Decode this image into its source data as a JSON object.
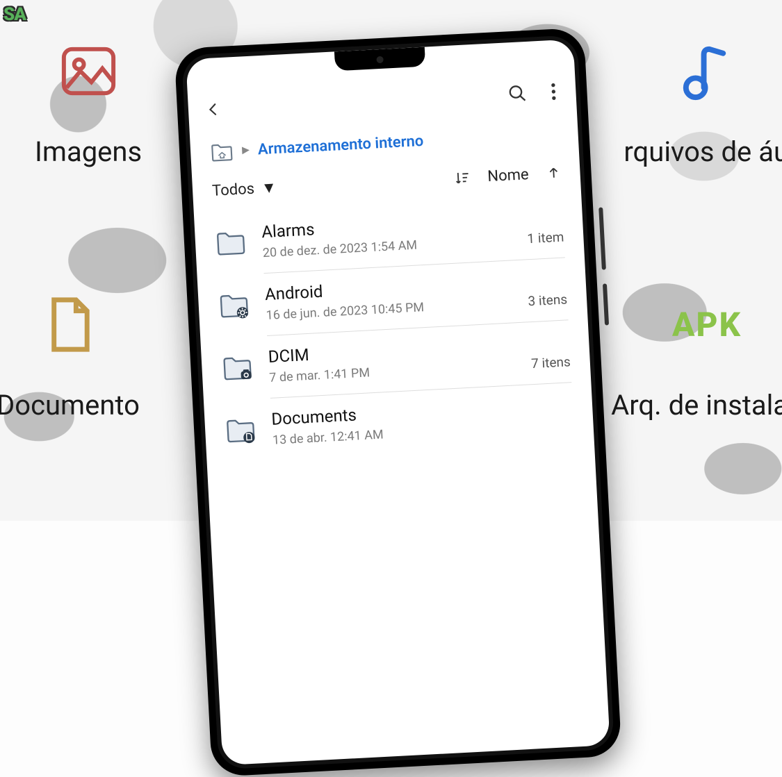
{
  "watermark": "SA",
  "categories": {
    "images_label": "Imagens",
    "audio_label": "rquivos de áu",
    "documents_label": "Documento",
    "apk_label": "Arq. de instalaç",
    "apk_icon_text": "APK"
  },
  "app": {
    "breadcrumb": {
      "current": "Armazenamento interno"
    },
    "filter": "Todos",
    "sort_label": "Nome",
    "folders": [
      {
        "name": "Alarms",
        "date": "20 de dez. de 2023 1:54 AM",
        "count": "1 item",
        "icon": "plain"
      },
      {
        "name": "Android",
        "date": "16 de jun. de 2023 10:45 PM",
        "count": "3 itens",
        "icon": "gear"
      },
      {
        "name": "DCIM",
        "date": "7 de mar. 1:41 PM",
        "count": "7 itens",
        "icon": "camera"
      },
      {
        "name": "Documents",
        "date": "13 de abr. 12:41 AM",
        "count": "",
        "icon": "doc"
      }
    ]
  }
}
